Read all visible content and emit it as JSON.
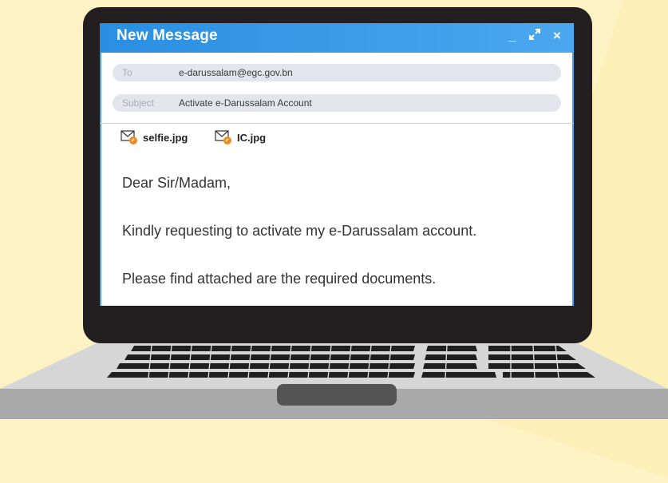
{
  "window": {
    "title": "New Message",
    "controls": [
      "_",
      "↙↗",
      "×"
    ]
  },
  "fields": {
    "to_label": "To",
    "to_value": "e-darussalam@egc.gov.bn",
    "subject_label": "Subject",
    "subject_value": "Activate e-Darussalam Account"
  },
  "attachments": [
    {
      "name": "selfie.jpg",
      "icon": "attachment-mail-icon"
    },
    {
      "name": "IC.jpg",
      "icon": "attachment-mail-icon"
    }
  ],
  "message": {
    "greeting": "Dear Sir/Madam,",
    "line1": "Kindly requesting to activate my e-Darussalam account.",
    "line2": "Please find attached are the required documents."
  },
  "colors": {
    "background": "#fdf2c4",
    "titlebar": "#2a8ee0",
    "laptop_body": "#d4d4d4",
    "bezel": "#231f20",
    "attachment_accent": "#f08c1e"
  }
}
